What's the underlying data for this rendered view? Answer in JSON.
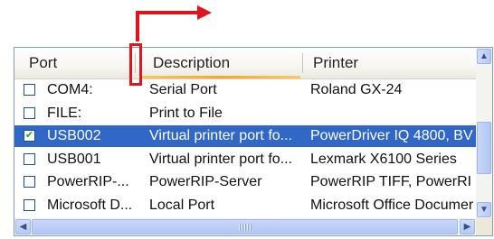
{
  "colors": {
    "selection": "#3167c6",
    "annotation": "#e0151b",
    "sort_indicator": "#f4a828",
    "border": "#7f9db9"
  },
  "header": {
    "columns": [
      "Port",
      "Description",
      "Printer"
    ]
  },
  "rows": [
    {
      "port": "COM4:",
      "description": "Serial Port",
      "printer": "Roland GX-24",
      "checked": false,
      "selected": false
    },
    {
      "port": "FILE:",
      "description": "Print to File",
      "printer": "",
      "checked": false,
      "selected": false
    },
    {
      "port": "USB002",
      "description": "Virtual printer port fo...",
      "printer": "PowerDriver IQ 4800, BV",
      "checked": true,
      "selected": true
    },
    {
      "port": "USB001",
      "description": "Virtual printer port fo...",
      "printer": "Lexmark X6100 Series",
      "checked": false,
      "selected": false
    },
    {
      "port": "PowerRIP-...",
      "description": "PowerRIP-Server",
      "printer": "PowerRIP TIFF, PowerRI",
      "checked": false,
      "selected": false
    },
    {
      "port": "Microsoft D...",
      "description": "Local Port",
      "printer": "Microsoft Office Documer",
      "checked": false,
      "selected": false
    }
  ],
  "icons": {
    "scroll_up": "up-arrow-icon",
    "scroll_down": "down-arrow-icon",
    "scroll_left": "left-arrow-icon",
    "scroll_right": "right-arrow-icon",
    "checkmark": "checkmark-icon",
    "annotation_arrow": "red-arrow-icon"
  }
}
